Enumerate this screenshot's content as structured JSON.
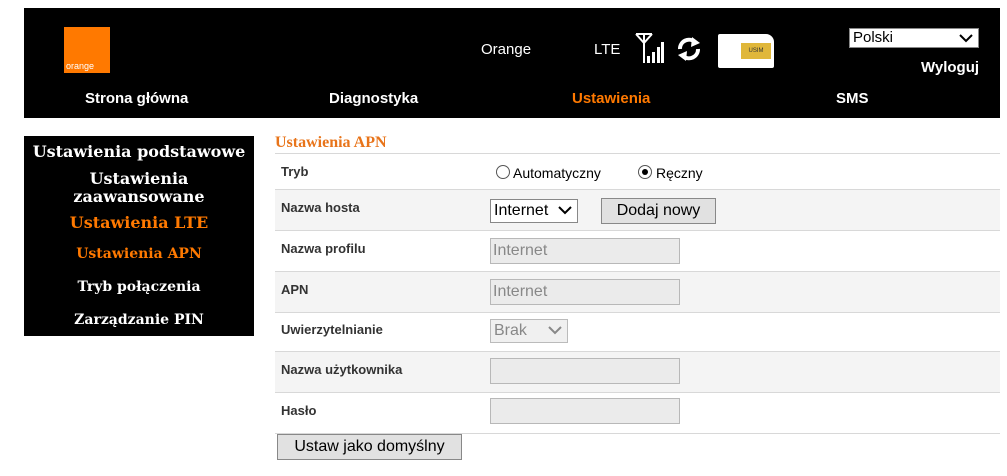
{
  "header": {
    "logo_text": "orange",
    "operator": "Orange",
    "network_type": "LTE",
    "sim_label": "USIM",
    "language": "Polski",
    "logout": "Wyloguj",
    "accent_color": "#ff7900",
    "icons": [
      "signal-icon",
      "refresh-icon",
      "sim-card-icon"
    ]
  },
  "nav": {
    "items": [
      {
        "label": "Strona główna",
        "active": false
      },
      {
        "label": "Diagnostyka",
        "active": false
      },
      {
        "label": "Ustawienia",
        "active": true
      },
      {
        "label": "SMS",
        "active": false
      }
    ]
  },
  "sidebar": {
    "items": [
      {
        "label": "Ustawienia podstawowe"
      },
      {
        "label": "Ustawienia zaawansowane"
      },
      {
        "label": "Ustawienia LTE",
        "active": true
      },
      {
        "label": "Ustawienia APN",
        "active": true
      },
      {
        "label": "Tryb połączenia"
      },
      {
        "label": "Zarządzanie PIN"
      }
    ]
  },
  "main": {
    "title": "Ustawienia APN",
    "mode": {
      "label": "Tryb",
      "options": [
        "Automatyczny",
        "Ręczny"
      ],
      "selected": "Ręczny"
    },
    "host": {
      "label": "Nazwa hosta",
      "value": "Internet",
      "add_button": "Dodaj nowy"
    },
    "profile": {
      "label": "Nazwa profilu",
      "value": "Internet"
    },
    "apn": {
      "label": "APN",
      "value": "Internet"
    },
    "auth": {
      "label": "Uwierzytelnianie",
      "value": "Brak"
    },
    "username": {
      "label": "Nazwa użytkownika",
      "value": ""
    },
    "password": {
      "label": "Hasło",
      "value": ""
    },
    "default_button": "Ustaw jako domyślny"
  }
}
